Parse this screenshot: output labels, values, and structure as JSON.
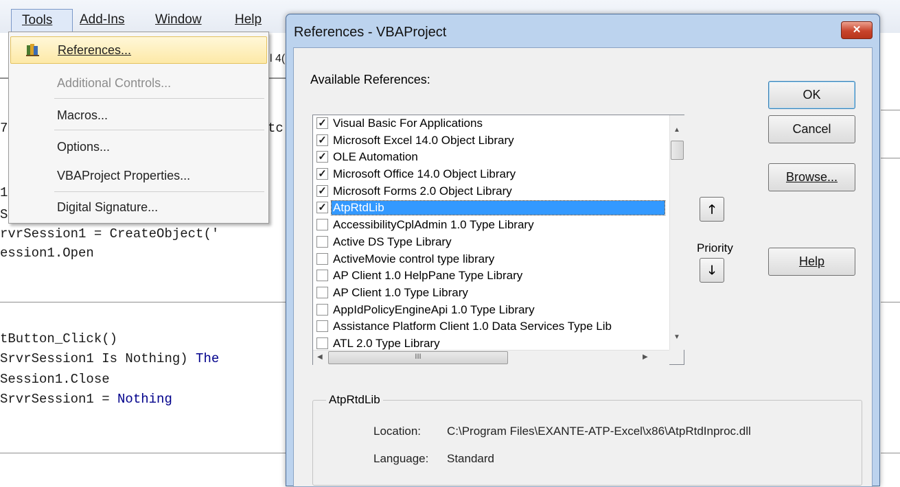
{
  "editor": {
    "menu": {
      "tools": "Tools",
      "add_ins": "Add-Ins",
      "window": "Window",
      "help": "Help"
    },
    "toolbar_fragment": "l 4(",
    "code_lines": {
      "l1": "7",
      "l1b": "tc",
      "l2": "1",
      "l3": "S",
      "l4": "rvrSession1 = CreateObject('",
      "l5": "ession1.Open",
      "l6": "tButton_Click()",
      "l7a": "SrvrSession1 Is Nothing) ",
      "l7b": "The",
      "l8": "Session1.Close",
      "l9a": "SrvrSession1 = ",
      "l9b": "Nothing"
    }
  },
  "tools_menu": {
    "items": [
      {
        "label": "References...",
        "state": "highlighted"
      },
      {
        "label": "Additional Controls...",
        "state": "disabled"
      },
      {
        "label": "Macros...",
        "state": "normal"
      },
      {
        "label": "Options...",
        "state": "normal"
      },
      {
        "label": "VBAProject Properties...",
        "state": "normal"
      },
      {
        "label": "Digital Signature...",
        "state": "normal"
      }
    ]
  },
  "dialog": {
    "title": "References - VBAProject",
    "close_glyph": "✕",
    "available_label": "Available References:",
    "buttons": {
      "ok": "OK",
      "cancel": "Cancel",
      "browse": "Browse...",
      "help": "Help"
    },
    "priority_label": "Priority",
    "priority_up": "🡑",
    "priority_down": "🡓",
    "references": [
      {
        "name": "Visual Basic For Applications",
        "checked": true
      },
      {
        "name": "Microsoft Excel 14.0 Object Library",
        "checked": true
      },
      {
        "name": "OLE Automation",
        "checked": true
      },
      {
        "name": "Microsoft Office 14.0 Object Library",
        "checked": true
      },
      {
        "name": "Microsoft Forms 2.0 Object Library",
        "checked": true
      },
      {
        "name": "AtpRtdLib",
        "checked": true,
        "selected": true
      },
      {
        "name": "AccessibilityCplAdmin 1.0 Type Library",
        "checked": false
      },
      {
        "name": "Active DS Type Library",
        "checked": false
      },
      {
        "name": "ActiveMovie control type library",
        "checked": false
      },
      {
        "name": "AP Client 1.0 HelpPane Type Library",
        "checked": false
      },
      {
        "name": "AP Client 1.0 Type Library",
        "checked": false
      },
      {
        "name": "AppIdPolicyEngineApi 1.0 Type Library",
        "checked": false
      },
      {
        "name": "Assistance Platform Client 1.0 Data Services Type Lib",
        "checked": false
      },
      {
        "name": "ATL 2.0 Type Library",
        "checked": false
      }
    ],
    "scroll_arrows": {
      "up": "▲",
      "down": "▼",
      "left": "◀",
      "right": "▶",
      "grip": "III"
    },
    "details": {
      "group_title": "AtpRtdLib",
      "location_label": "Location:",
      "location_value": "C:\\Program Files\\EXANTE-ATP-Excel\\x86\\AtpRtdInproc.dll",
      "language_label": "Language:",
      "language_value": "Standard"
    }
  }
}
